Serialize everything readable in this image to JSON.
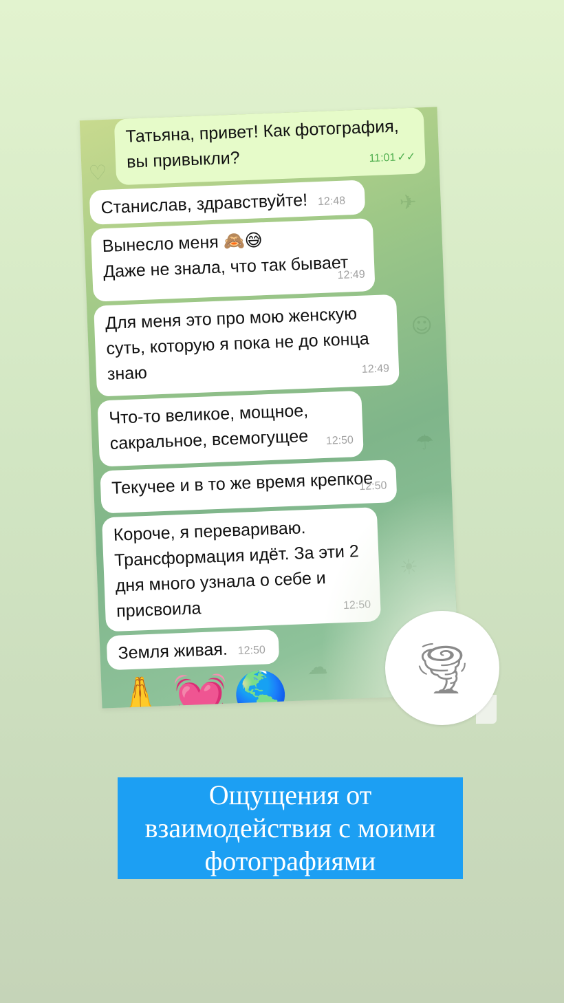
{
  "chat": {
    "messages": [
      {
        "text": "Татьяна, привет! Как фотография,\nвы привыкли?",
        "time": "11:01",
        "read_mark": "✓✓"
      },
      {
        "text": "Станислав, здравствуйте!",
        "time": "12:48"
      },
      {
        "text": "Вынесло меня 🙈😅\nДаже не знала, что так бывает",
        "time": "12:49"
      },
      {
        "text": "Для меня это про мою женскую\nсуть, которую я пока не до конца\nзнаю",
        "time": "12:49"
      },
      {
        "text": "Что-то великое, мощное,\nсакральное, всемогущее",
        "time": "12:50"
      },
      {
        "text": "Текучее и в то же время крепкое",
        "time": "12:50"
      },
      {
        "text": "Короче, я перевариваю.\nТрансформация идёт. За эти 2\nдня много узнала о себе и\nприсвоила",
        "time": "12:50"
      },
      {
        "text": "Земля живая.",
        "time": "12:50"
      }
    ],
    "emoji_row": "🙏💓🌎",
    "emoji_bubble": "🌪",
    "colors": {
      "incoming": "#ffffff",
      "outgoing": "#e6fbc9",
      "time_out": "#4fae4e",
      "time_in": "#a2a2a2"
    }
  },
  "caption": {
    "text": "Ощущения от\nвзаимодействия с моими\nфотографиями",
    "background": "#1c9ff3"
  },
  "icons": [
    "read-receipt-icon",
    "tornado-icon"
  ]
}
